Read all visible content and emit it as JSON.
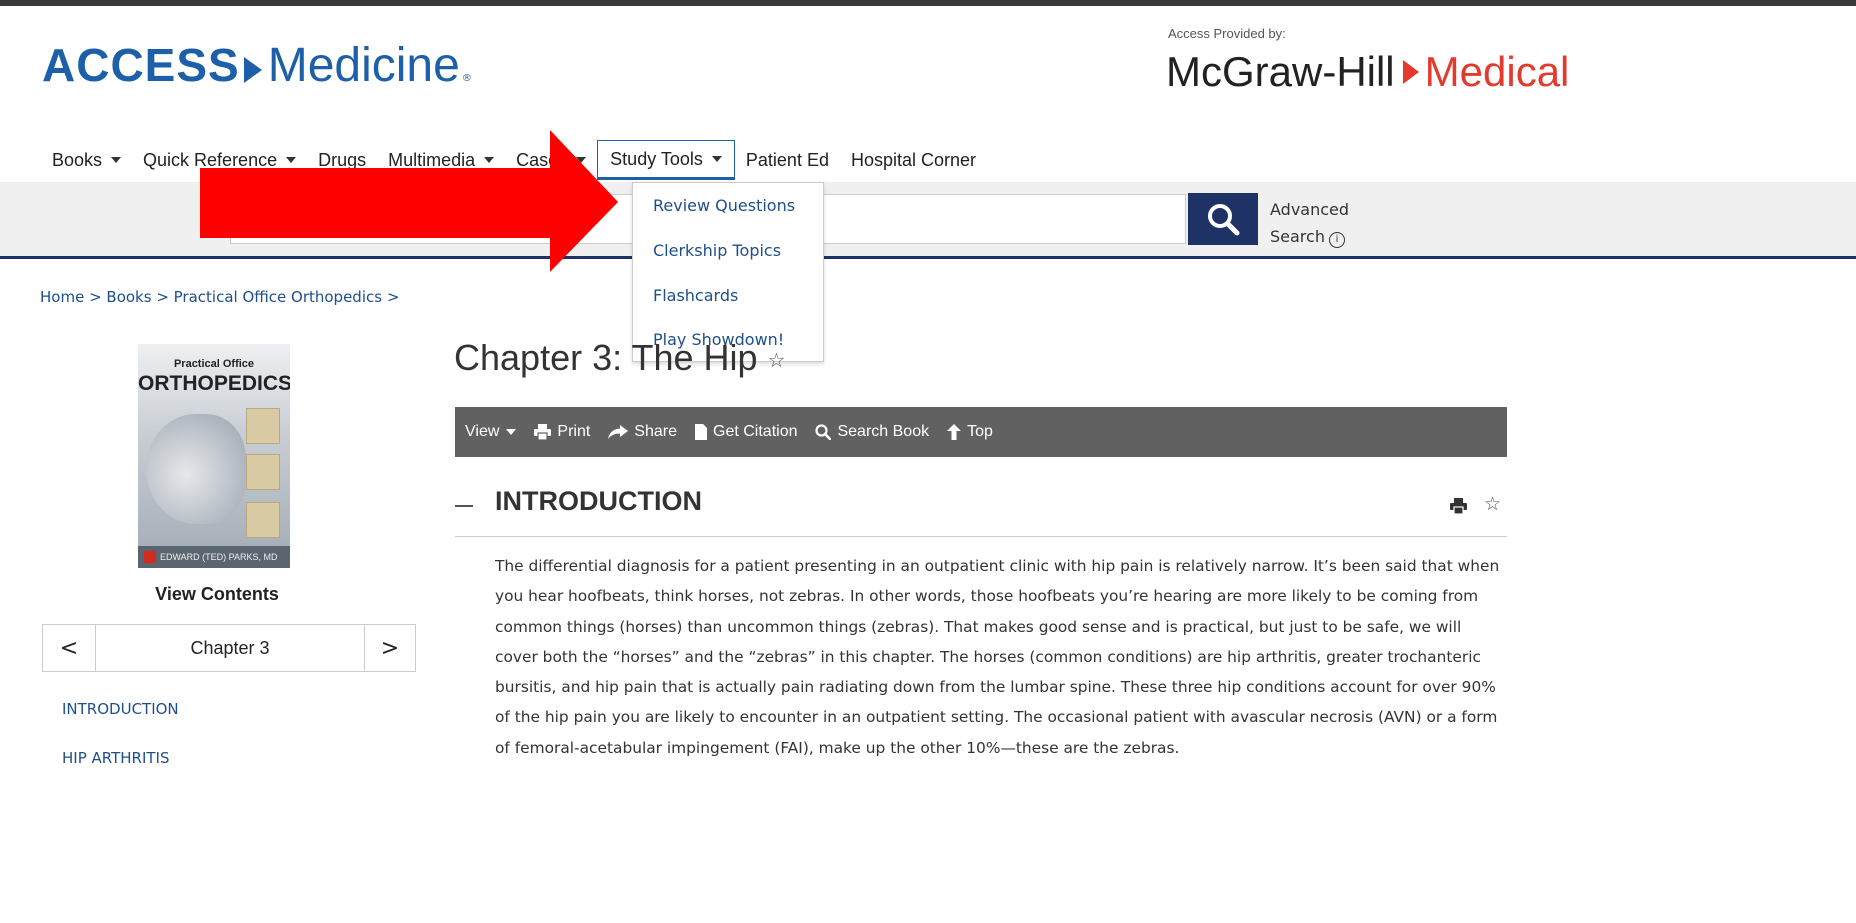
{
  "header": {
    "logo_left": {
      "access": "ACCESS",
      "medicine": "Medicine",
      "reg": "®"
    },
    "provided_by": "Access Provided by:",
    "logo_right": {
      "mcgraw": "McGraw-Hill",
      "medical": "Medical"
    }
  },
  "nav": {
    "items": [
      {
        "label": "Books",
        "has_caret": true
      },
      {
        "label": "Quick Reference",
        "has_caret": true
      },
      {
        "label": "Drugs",
        "has_caret": false
      },
      {
        "label": "Multimedia",
        "has_caret": true
      },
      {
        "label": "Cases",
        "has_caret": true
      },
      {
        "label": "Study Tools",
        "has_caret": true,
        "active": true
      },
      {
        "label": "Patient Ed",
        "has_caret": false
      },
      {
        "label": "Hospital Corner",
        "has_caret": false
      }
    ]
  },
  "dropdown": {
    "items": [
      "Review Questions",
      "Clerkship Topics",
      "Flashcards",
      "Play Showdown!"
    ]
  },
  "search": {
    "placeholder": "",
    "advanced_line1": "Advanced",
    "advanced_line2": "Search",
    "info_glyph": "i"
  },
  "breadcrumb": "Home > Books > Practical Office Orthopedics >",
  "book": {
    "cover_title_small": "Practical Office",
    "cover_title_big": "ORTHOPEDICS",
    "cover_author": "EDWARD (TED) PARKS, MD",
    "view_contents": "View Contents",
    "chapter_nav": {
      "prev": "<",
      "label": "Chapter 3",
      "next": ">"
    },
    "toc": [
      "INTRODUCTION",
      "HIP ARTHRITIS"
    ]
  },
  "chapter": {
    "title": "Chapter 3: The Hip",
    "star": "☆"
  },
  "toolbar": {
    "view": "View",
    "print": "Print",
    "share": "Share",
    "citation": "Get Citation",
    "search_book": "Search Book",
    "top": "Top"
  },
  "section": {
    "title": "INTRODUCTION",
    "star": "☆",
    "paragraph": "The differential diagnosis for a patient presenting in an outpatient clinic with hip pain is relatively narrow. It’s been said that when you hear hoofbeats, think horses, not zebras. In other words, those hoofbeats you’re hearing are more likely to be coming from common things (horses) than uncommon things (zebras). That makes good sense and is practical, but just to be safe, we will cover both the “horses” and the “zebras” in this chapter. The horses (common conditions) are hip arthritis, greater trochanteric bursitis, and hip pain that is actually pain radiating down from the lumbar spine. These three hip conditions account for over 90% of the hip pain you are likely to encounter in an outpatient setting. The occasional patient with avascular necrosis (AVN) or a form of femoral-acetabular impingement (FAI), make up the other 10%—these are the zebras."
  },
  "colors": {
    "brand_blue": "#1d5fa8",
    "navy": "#1e3266",
    "mh_red": "#e23b2e",
    "toolbar_gray": "#616161",
    "annotation_red": "#ff0000"
  }
}
